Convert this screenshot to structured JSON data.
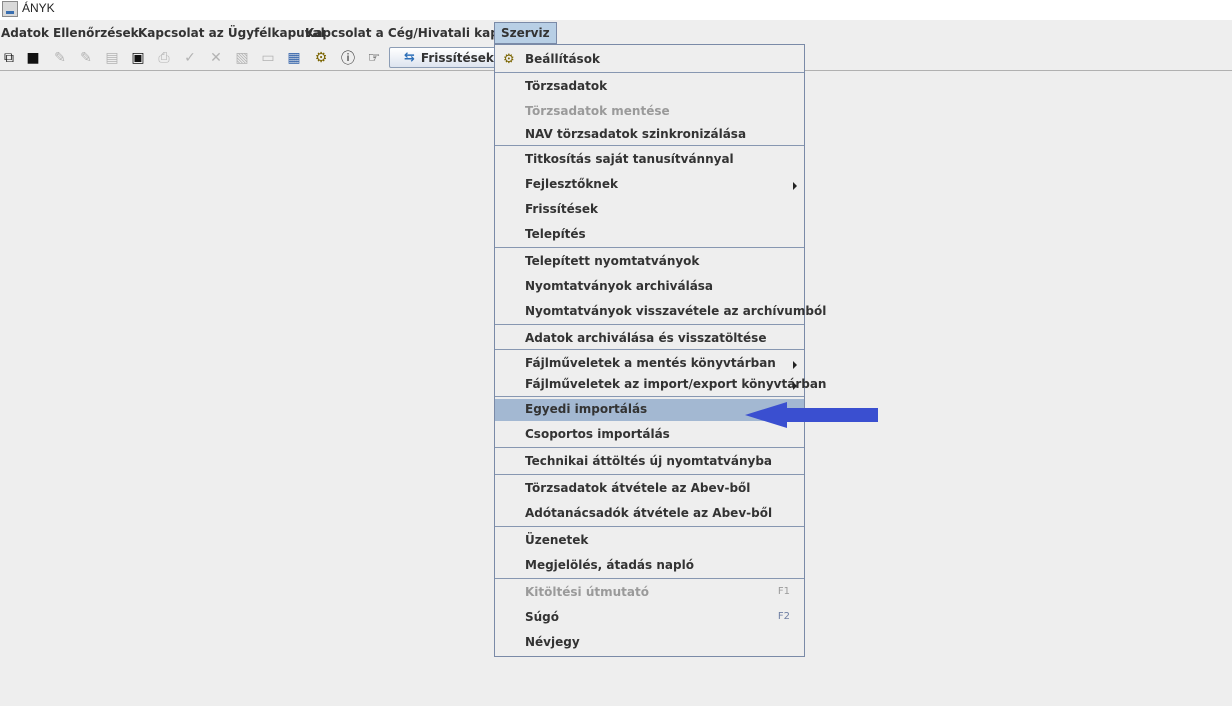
{
  "window": {
    "title": "ÁNYK"
  },
  "menubar": {
    "items": [
      {
        "label": "Adatok"
      },
      {
        "label": "Ellenőrzések"
      },
      {
        "label": "Kapcsolat az Ügyfélkapuval"
      },
      {
        "label": "Kapcsolat a Cég/Hivatali kapuval"
      },
      {
        "label": "Szerviz"
      }
    ]
  },
  "toolbar": {
    "refresh_label": "Frissítések",
    "icons": [
      "copy-icon",
      "save-icon",
      "edit-form-icon",
      "check-form-icon",
      "print-preview-icon",
      "id-card-icon",
      "print-icon",
      "checkmark-icon",
      "cross-icon",
      "document-icon",
      "keyboard-icon",
      "calculator-icon",
      "gears-icon",
      "info-icon",
      "hand-pointer-icon",
      "refresh-icon"
    ]
  },
  "dropdown": {
    "items": [
      {
        "label": "Beállítások",
        "icon": "gears-icon"
      },
      {
        "label": "Törzsadatok"
      },
      {
        "label": "Törzsadatok mentése",
        "disabled": true
      },
      {
        "label": "NAV törzsadatok szinkronizálása"
      },
      {
        "label": "Titkosítás saját tanusítvánnyal"
      },
      {
        "label": "Fejlesztőknek",
        "submenu": true
      },
      {
        "label": "Frissítések"
      },
      {
        "label": "Telepítés"
      },
      {
        "label": "Telepített nyomtatványok"
      },
      {
        "label": "Nyomtatványok archiválása"
      },
      {
        "label": "Nyomtatványok visszavétele az archívumból"
      },
      {
        "label": "Adatok archiválása és visszatöltése"
      },
      {
        "label": "Fájlműveletek a mentés könyvtárban",
        "submenu": true
      },
      {
        "label": "Fájlműveletek az import/export könyvtárban",
        "submenu": true
      },
      {
        "label": "Egyedi importálás",
        "highlighted": true
      },
      {
        "label": "Csoportos importálás"
      },
      {
        "label": "Technikai áttöltés új nyomtatványba"
      },
      {
        "label": "Törzsadatok átvétele az Abev-ből"
      },
      {
        "label": "Adótanácsadók átvétele az Abev-ből"
      },
      {
        "label": "Üzenetek"
      },
      {
        "label": "Megjelölés, átadás napló"
      },
      {
        "label": "Kitöltési útmutató",
        "disabled": true,
        "accelerator": "F1"
      },
      {
        "label": "Súgó",
        "accelerator": "F2"
      },
      {
        "label": "Névjegy"
      }
    ]
  },
  "colors": {
    "menu_highlight": "#a3b8d2",
    "arrow": "#3a4fd0",
    "separator": "#8797b1"
  }
}
